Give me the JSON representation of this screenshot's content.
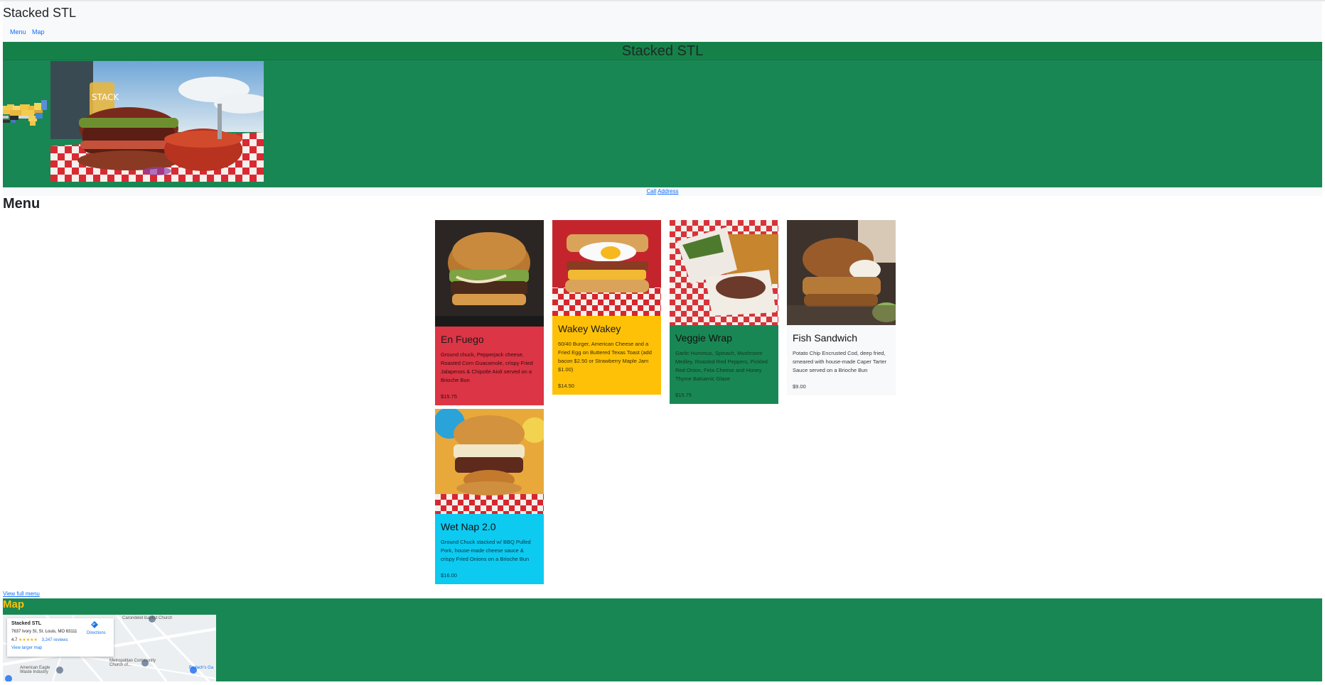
{
  "navbar": {
    "brand": "Stacked STL",
    "links": [
      "Menu",
      "Map"
    ]
  },
  "hero": {
    "title": "Stacked STL"
  },
  "contact": {
    "call": "Call",
    "address": "Address"
  },
  "menu": {
    "heading": "Menu",
    "items": [
      {
        "name": "En Fuego",
        "description": "Ground chuck, Pepperjack cheese, Roasted Corn Guacamole, crispy Fried Jalapenos & Chipotle Aioli served on a Brioche Bun",
        "price": "$15.75"
      },
      {
        "name": "Wakey Wakey",
        "description": "60/40 Burger, American Cheese and a Fried Egg on Buttered Texas Toast (add bacon $2.50 or Strawberry Maple Jam $1.00)",
        "price": "$14.50"
      },
      {
        "name": "Veggie Wrap",
        "description": "Garlic Hummus, Spinach, Mushroom Medley, Roasted Red Peppers, Pickled Red Onion, Feta Cheese and Honey Thyme Balsamic Glaze",
        "price": "$15.75"
      },
      {
        "name": "Fish Sandwich",
        "description": "Potato Chip Encrusted Cod, deep fried, smeared with house-made Caper Tarter Sauce served on a Brioche Bun",
        "price": "$9.00"
      },
      {
        "name": "Wet Nap 2.0",
        "description": "Ground Chuck stacked w/ BBQ Pulled Pork, house-made cheese sauce & crispy Fried Onions on a Brioche Bun",
        "price": "$16.00"
      }
    ],
    "full_menu_link": "View full menu"
  },
  "map": {
    "heading": "Map",
    "card": {
      "name": "Stacked STL",
      "address": "7637 Ivory St, St. Louis, MO 63111",
      "rating": "4.7",
      "stars": "★★★★★",
      "reviews": "3,247 reviews",
      "larger": "View larger map",
      "directions": "Directions"
    },
    "labels": [
      "Carondelet Baptist Church",
      "Metropolitan Community Church of...",
      "American Eagle Waste Industry",
      "Bodach's Ga"
    ]
  },
  "colors": {
    "primary_green": "#198754",
    "danger_red": "#dc3545",
    "warning_yellow": "#ffc107",
    "info_cyan": "#0dcaf0",
    "light": "#f8f9fa",
    "link_blue": "#0d6efd"
  }
}
